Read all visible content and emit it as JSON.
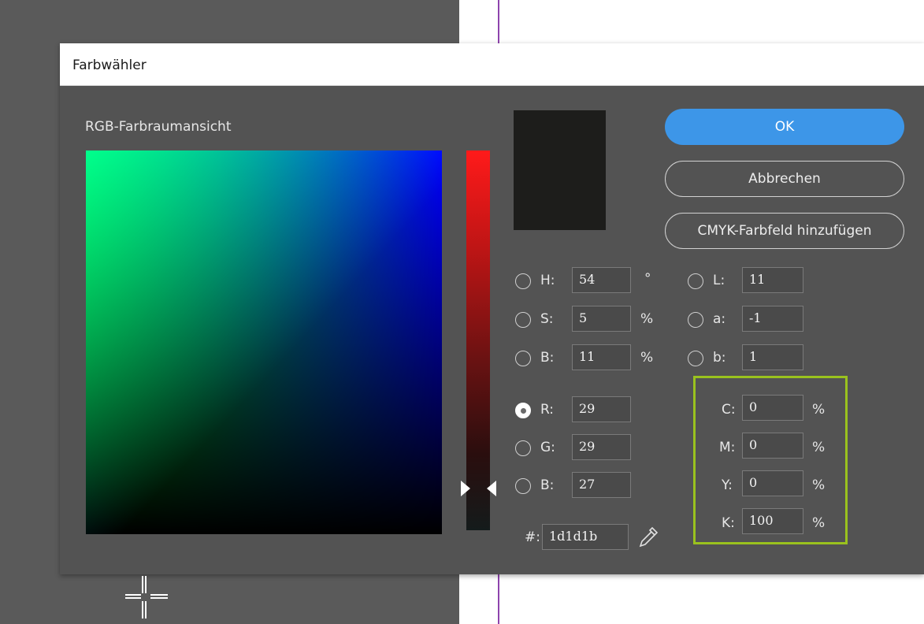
{
  "window": {
    "title": "Farbwähler"
  },
  "view_label": "RGB-Farbraumansicht",
  "preview_color": "#1d1d1b",
  "accent_color": "#3d96e8",
  "highlight_color": "#9ac21e",
  "buttons": {
    "ok": "OK",
    "cancel": "Abbrechen",
    "add_swatch": "CMYK-Farbfeld hinzufügen"
  },
  "hsb": {
    "h": {
      "label": "H:",
      "value": "54",
      "unit": "°"
    },
    "s": {
      "label": "S:",
      "value": "5",
      "unit": "%"
    },
    "b": {
      "label": "B:",
      "value": "11",
      "unit": "%"
    }
  },
  "rgb": {
    "r": {
      "label": "R:",
      "value": "29",
      "checked": true
    },
    "g": {
      "label": "G:",
      "value": "29"
    },
    "b": {
      "label": "B:",
      "value": "27"
    }
  },
  "lab": {
    "l": {
      "label": "L:",
      "value": "11"
    },
    "a": {
      "label": "a:",
      "value": "-1"
    },
    "b": {
      "label": "b:",
      "value": "1"
    }
  },
  "cmyk": {
    "c": {
      "label": "C:",
      "value": "0",
      "unit": "%"
    },
    "m": {
      "label": "M:",
      "value": "0",
      "unit": "%"
    },
    "y": {
      "label": "Y:",
      "value": "0",
      "unit": "%"
    },
    "k": {
      "label": "K:",
      "value": "100",
      "unit": "%"
    }
  },
  "hex": {
    "label": "#:",
    "value": "1d1d1b"
  },
  "icons": {
    "eyedropper": "eyedropper-icon",
    "crosshair": "crosshair-icon"
  }
}
